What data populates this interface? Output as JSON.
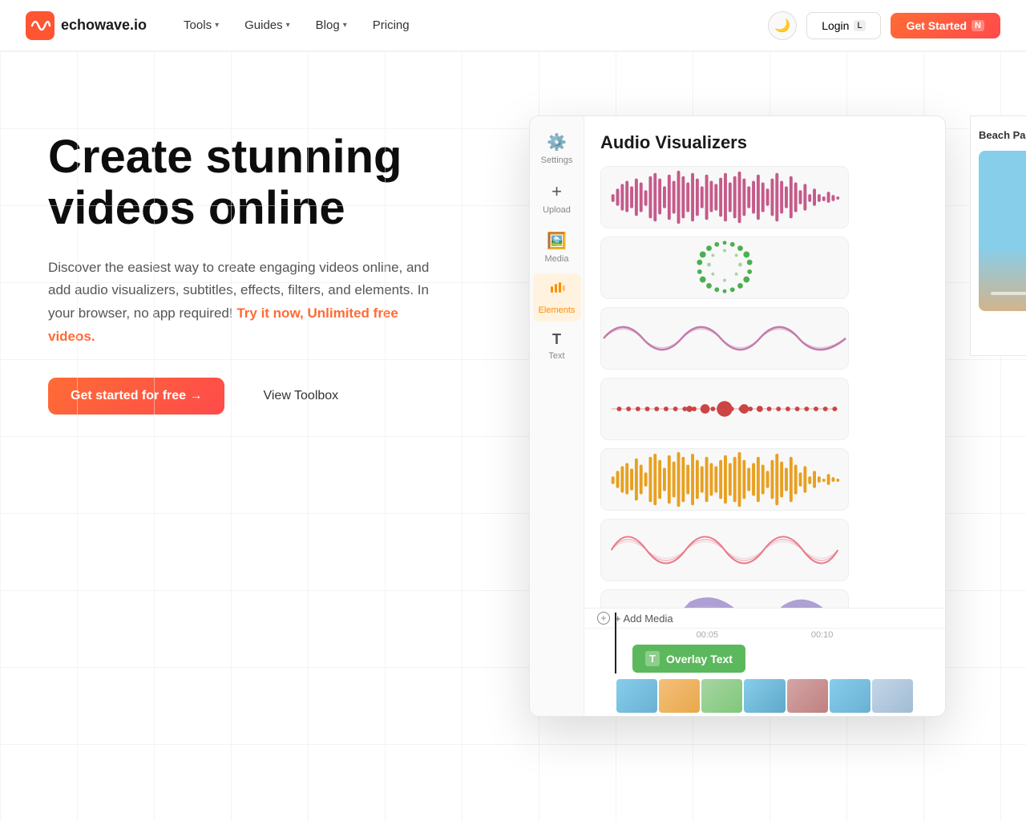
{
  "nav": {
    "logo_text": "echowave.io",
    "links": [
      {
        "label": "Tools",
        "has_dropdown": true
      },
      {
        "label": "Guides",
        "has_dropdown": true
      },
      {
        "label": "Blog",
        "has_dropdown": true
      },
      {
        "label": "Pricing",
        "has_dropdown": false
      }
    ],
    "login_label": "Login",
    "login_kbd": "L",
    "get_started_label": "Get Started",
    "get_started_kbd": "N"
  },
  "hero": {
    "heading_line1": "Create stunning",
    "heading_line2": "videos online",
    "description_plain": "Discover the easiest way to create engaging videos online, and add audio visualizers, subtitles, effects, filters, and elements. In your browser, no app required!",
    "description_bold": "Try it now, Unlimited free videos.",
    "cta_primary": "Get started for free →",
    "cta_secondary": "View Toolbox"
  },
  "editor": {
    "panel_title": "Audio Visualizers",
    "right_panel_label": "Beach Par",
    "sidebar": [
      {
        "label": "Settings",
        "icon": "⚙",
        "active": false
      },
      {
        "label": "Upload",
        "icon": "+",
        "active": false
      },
      {
        "label": "Media",
        "icon": "🖼",
        "active": false
      },
      {
        "label": "Elements",
        "icon": "♪",
        "active": true
      },
      {
        "label": "Text",
        "icon": "T",
        "active": false
      }
    ],
    "visualizers": [
      {
        "type": "bars",
        "color": "#c44"
      },
      {
        "type": "circle",
        "color": "#5c5"
      },
      {
        "type": "wave",
        "color": "#c4a"
      },
      {
        "type": "dots",
        "color": "#c44"
      },
      {
        "type": "waveform",
        "color": "#da4"
      },
      {
        "type": "loops",
        "color": "#e88"
      },
      {
        "type": "mountains",
        "color": "#a88"
      }
    ],
    "timeline": {
      "add_media_label": "+ Add Media",
      "marks": [
        "00:05",
        "00:10"
      ],
      "overlay_text_label": "Overlay Text",
      "overlay_text_icon": "T"
    }
  }
}
